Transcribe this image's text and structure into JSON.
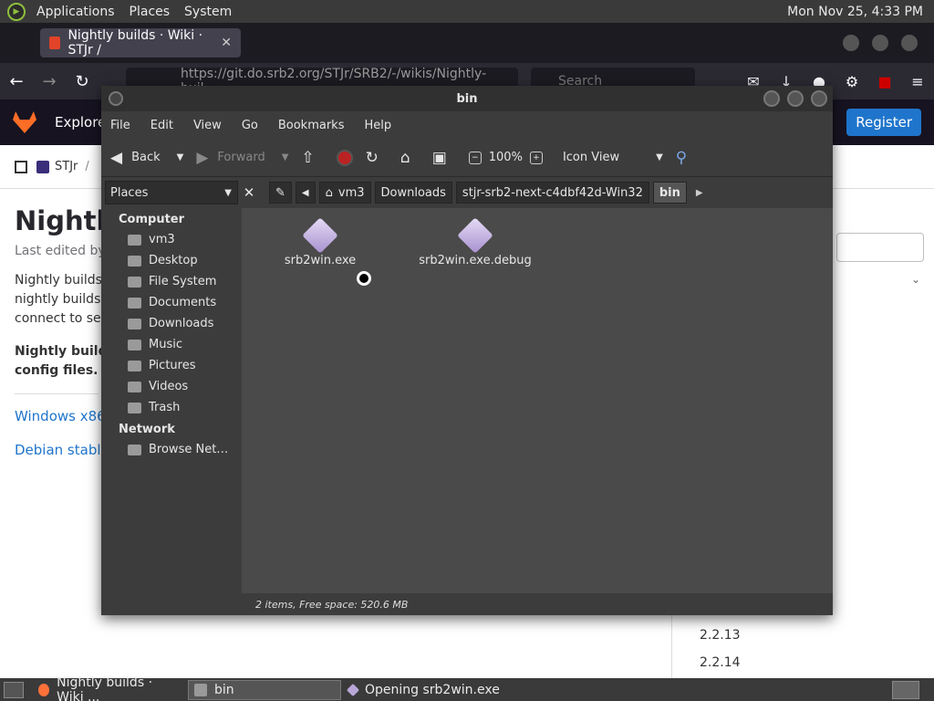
{
  "top_panel": {
    "menus": [
      "Applications",
      "Places",
      "System"
    ],
    "clock": "Mon Nov 25,  4:33 PM"
  },
  "firefox": {
    "tab_title": "Nightly builds · Wiki · STJr /",
    "tab_close": "✕",
    "url": "https://git.do.srb2.org/STJr/SRB2/-/wikis/Nightly-buil...",
    "search_placeholder": "Search",
    "gitlab": {
      "explore": "Explore",
      "register": "Register",
      "breadcrumb_project": "STJr",
      "breadcrumb_sep": "/",
      "page_title": "Nightly",
      "last_edited": "Last edited by",
      "intro_line1": "Nightly builds",
      "intro_line2": "nightly builds a",
      "intro_line3": "connect to ser",
      "bold_line1": "Nightly builds",
      "bold_line2": "config files.",
      "link_windows": "Windows x86",
      "link_debian": "Debian stable:",
      "versions": [
        "2.2.13",
        "2.2.14"
      ]
    }
  },
  "file_manager": {
    "title": "bin",
    "menus": [
      "File",
      "Edit",
      "View",
      "Go",
      "Bookmarks",
      "Help"
    ],
    "toolbar": {
      "back": "Back",
      "forward": "Forward",
      "zoom": "100%",
      "view_mode": "Icon View"
    },
    "sidebar_header": "Places",
    "path": [
      "vm3",
      "Downloads",
      "stjr-srb2-next-c4dbf42d-Win32",
      "bin"
    ],
    "sidebar": {
      "computer_label": "Computer",
      "computer_items": [
        "vm3",
        "Desktop",
        "File System",
        "Documents",
        "Downloads",
        "Music",
        "Pictures",
        "Videos",
        "Trash"
      ],
      "network_label": "Network",
      "network_items": [
        "Browse Net…"
      ]
    },
    "files": [
      {
        "name": "srb2win.exe"
      },
      {
        "name": "srb2win.exe.debug"
      }
    ],
    "status": "2 items, Free space: 520.6 MB"
  },
  "taskbar": {
    "tasks": [
      "Nightly builds · Wiki ...",
      "bin",
      "Opening srb2win.exe"
    ]
  }
}
